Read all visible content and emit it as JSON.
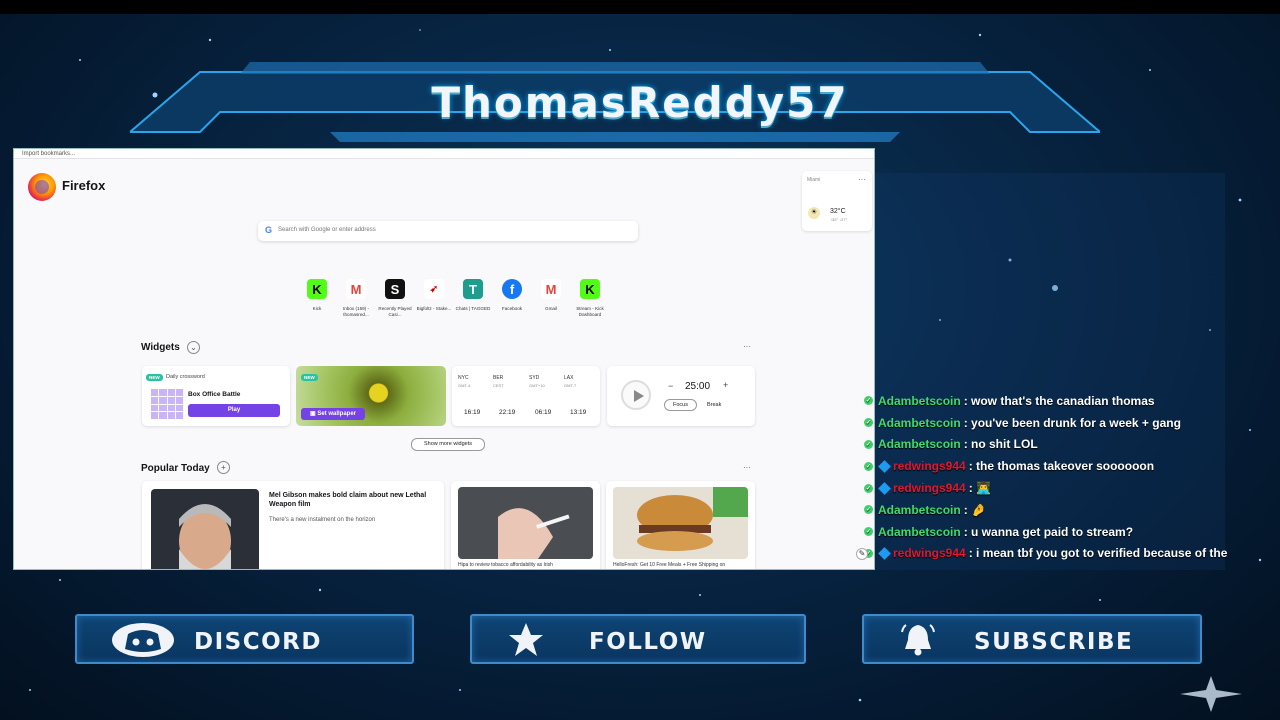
{
  "stream": {
    "title": "ThomasReddy57",
    "buttons": {
      "discord": "DISCORD",
      "follow": "FOLLOW",
      "subscribe": "SUBSCRIBE"
    }
  },
  "browser": {
    "bookmarks_bar": "Import bookmarks...",
    "app_name": "Firefox",
    "search_placeholder": "Search with Google or enter address",
    "weather": {
      "city": "Miami",
      "temp": "32°C",
      "highlow": "↑35°  ↓27°"
    },
    "shortcuts": [
      {
        "label": "Kick",
        "icon": "kick-icon"
      },
      {
        "label": "Inbox (159) - thomasred...",
        "icon": "gmail-icon"
      },
      {
        "label": "Recently Played Casi...",
        "icon": "stake-icon"
      },
      {
        "label": "Bigfoltz - Stake...",
        "icon": "bigfoltz-icon"
      },
      {
        "label": "Chats | TAGGED",
        "icon": "tagged-icon"
      },
      {
        "label": "Facebook",
        "icon": "facebook-icon"
      },
      {
        "label": "Gmail",
        "icon": "gmail-icon"
      },
      {
        "label": "Stream - Kick Dashboard",
        "icon": "kick-icon"
      }
    ],
    "widgets": {
      "title": "Widgets",
      "more": "···",
      "crossword": {
        "badge": "NEW",
        "label": "Daily crossword",
        "title": "Box Office Battle",
        "play": "Play"
      },
      "wallpaper": {
        "badge": "NEW",
        "button": "Set wallpaper"
      },
      "clocks": [
        {
          "city": "NYC",
          "offset": "GMT-4",
          "time": "16:19"
        },
        {
          "city": "BER",
          "offset": "CEST",
          "time": "22:19"
        },
        {
          "city": "SYD",
          "offset": "GMT+10",
          "time": "06:19"
        },
        {
          "city": "LAX",
          "offset": "GMT-7",
          "time": "13:19"
        }
      ],
      "timer": {
        "minus": "−",
        "time": "25:00",
        "plus": "+",
        "focus": "Focus",
        "break": "Break"
      },
      "show_more": "Show more widgets"
    },
    "popular": {
      "title": "Popular Today",
      "more": "···",
      "lead": {
        "title": "Mel Gibson makes bold claim about new Lethal Weapon film",
        "subtitle": "There's a new instalment on the horizon"
      },
      "captions": [
        "Hipa to review tobacco affordability as Irish",
        "HelloFresh: Get 10 Free Meals + Free Shipping on"
      ]
    }
  },
  "chat": [
    {
      "user": "Adambetscoin",
      "color": "green",
      "gem": false,
      "text": ": wow that's the canadian thomas"
    },
    {
      "user": "Adambetscoin",
      "color": "green",
      "gem": false,
      "text": ": you've been drunk for a week + gang"
    },
    {
      "user": "Adambetscoin",
      "color": "green",
      "gem": false,
      "text": ": no shit LOL"
    },
    {
      "user": "redwings944",
      "color": "red",
      "gem": true,
      "text": ": the thomas takeover soooooon"
    },
    {
      "user": "redwings944",
      "color": "red",
      "gem": true,
      "text": ": 👨‍💻"
    },
    {
      "user": "Adambetscoin",
      "color": "green",
      "gem": false,
      "text": ": 🤌"
    },
    {
      "user": "Adambetscoin",
      "color": "green",
      "gem": false,
      "text": ": u wanna get paid to stream?"
    },
    {
      "user": "redwings944",
      "color": "red",
      "gem": true,
      "text": ": i mean tbf you got to verified because of the raid"
    }
  ],
  "colors": {
    "firefox_purple": "#7542e5",
    "chat_green": "#3fdc6a",
    "chat_red": "#e0172f",
    "new_badge": "#2ac3a2"
  }
}
